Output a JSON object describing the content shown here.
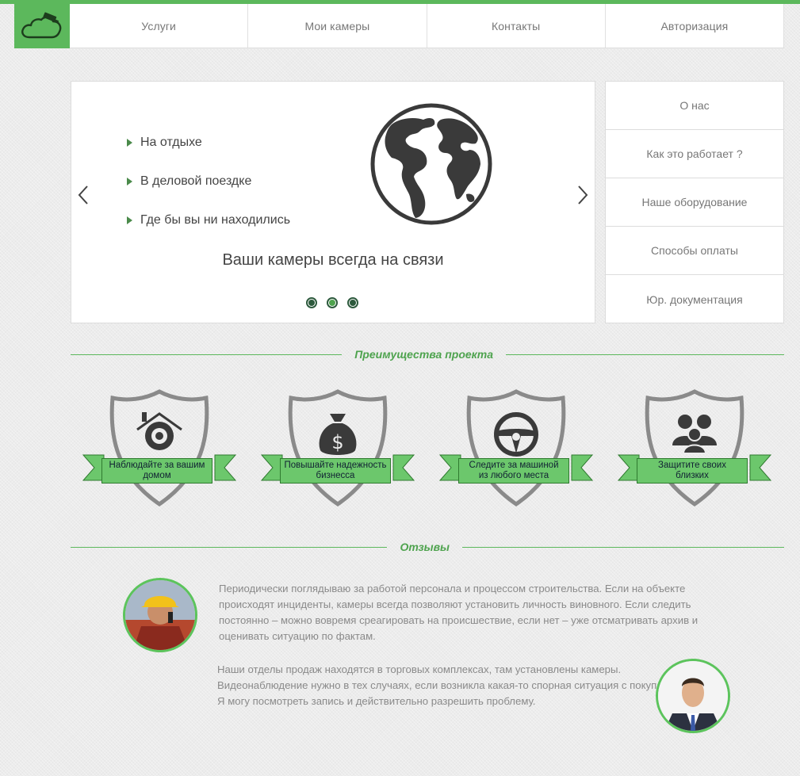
{
  "nav": {
    "logo_icon": "cloud-camera-icon",
    "items": [
      "Услуги",
      "Мои камеры",
      "Контакты",
      "Авторизация"
    ]
  },
  "slider": {
    "bullets": [
      "На отдыхе",
      "В деловой поездке",
      "Где бы вы ни находились"
    ],
    "caption": "Ваши камеры всегда на связи",
    "image_icon": "globe-icon",
    "prev_icon": "chevron-left-icon",
    "next_icon": "chevron-right-icon",
    "slide_count": 3,
    "active_slide": 2
  },
  "side_menu": [
    "О нас",
    "Как это работает ?",
    "Наше оборудование",
    "Способы оплаты",
    "Юр. документация"
  ],
  "advantages": {
    "title": "Преимущества проекта",
    "items": [
      {
        "label_line1": "Наблюдайте за вашим",
        "label_line2": "домом",
        "icon": "house-camera-icon"
      },
      {
        "label_line1": "Повышайте надежность",
        "label_line2": "бизнесса",
        "icon": "money-bag-icon"
      },
      {
        "label_line1": "Следите за машиной",
        "label_line2": "из любого места",
        "icon": "steering-wheel-icon"
      },
      {
        "label_line1": "Защитите своих",
        "label_line2": "близких",
        "icon": "family-icon"
      }
    ]
  },
  "reviews": {
    "title": "Отзывы",
    "items": [
      {
        "avatar": "worker-avatar",
        "lines": [
          "Периодически поглядываю за работой персонала и процессом строительства. Если на объекте",
          "происходят инциденты, камеры всегда позволяют установить личность виновного. Если следить",
          "постоянно – можно вовремя среагировать на происшествие, если нет – уже отсматривать архив и",
          "оценивать ситуацию по фактам."
        ]
      },
      {
        "avatar": "businessman-avatar",
        "lines": [
          "Наши отделы продаж находятся в торговых комплексах, там установлены камеры.",
          "Видеонаблюдение нужно в тех случаях, если возникла какая-то спорная ситуация с покупателем.",
          "Я могу посмотреть запись и действительно разрешить проблему."
        ]
      }
    ]
  },
  "colors": {
    "accent": "#5cb85c",
    "title_green": "#4ea34e",
    "ribbon": "#6cc76c",
    "icon_dark": "#3a3a3a",
    "shield_gray": "#8a8a8a"
  }
}
